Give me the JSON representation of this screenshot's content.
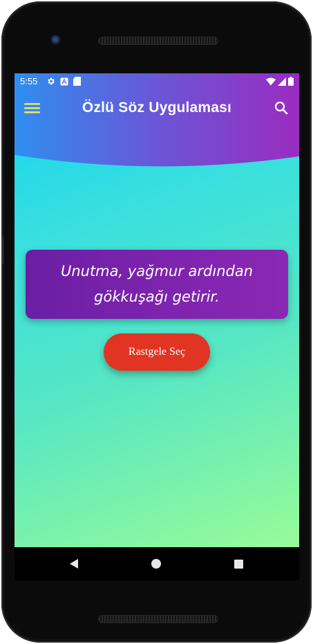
{
  "status_bar": {
    "time": "5:55",
    "left_icons": [
      "settings-icon",
      "a-badge-icon",
      "sd-card-icon"
    ],
    "right_icons": [
      "wifi-icon",
      "signal-icon",
      "battery-icon"
    ]
  },
  "app_bar": {
    "title": "Özlü Söz Uygulaması",
    "menu_icon": "hamburger-menu-icon",
    "search_icon": "search-icon"
  },
  "quote": {
    "text": "Unutma, yağmur ardından gökkuşağı getirir."
  },
  "actions": {
    "random_label": "Rastgele Seç"
  },
  "navigation": {
    "back_icon": "back-triangle-icon",
    "home_icon": "home-circle-icon",
    "recents_icon": "recents-square-icon"
  },
  "colors": {
    "header_gradient_start": "#2f8ef0",
    "header_gradient_end": "#9a2cc0",
    "background_gradient_start": "#12d2f3",
    "background_gradient_end": "#98fb98",
    "quote_card": "#7d23ad",
    "button": "#e23422",
    "menu_icon": "#f2e45a"
  }
}
